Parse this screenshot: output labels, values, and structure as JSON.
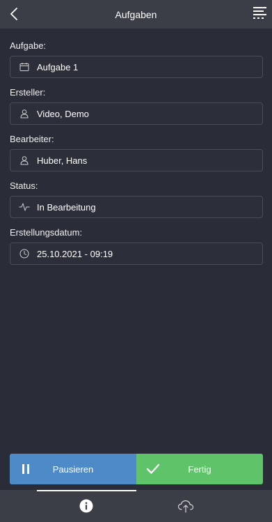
{
  "header": {
    "title": "Aufgaben",
    "back_icon": "chevron-left-icon",
    "menu_icon": "menu-list-icon"
  },
  "fields": [
    {
      "label": "Aufgabe:",
      "value": "Aufgabe 1",
      "icon": "calendar-icon"
    },
    {
      "label": "Ersteller:",
      "value": "Video, Demo",
      "icon": "person-icon"
    },
    {
      "label": "Bearbeiter:",
      "value": "Huber, Hans",
      "icon": "person-icon"
    },
    {
      "label": "Status:",
      "value": "In Bearbeitung",
      "icon": "activity-icon"
    },
    {
      "label": "Erstellungsdatum:",
      "value": "25.10.2021 - 09:19",
      "icon": "clock-icon"
    }
  ],
  "actions": {
    "pause_label": "Pausieren",
    "done_label": "Fertig",
    "pause_color": "#4f8ac8",
    "done_color": "#5fc36a"
  },
  "tabbar": {
    "info_icon": "info-icon",
    "upload_icon": "cloud-upload-icon",
    "active_tab": "info"
  },
  "colors": {
    "background": "#2a2d38",
    "header": "#3b3e46",
    "field_border": "#4a4d58"
  }
}
